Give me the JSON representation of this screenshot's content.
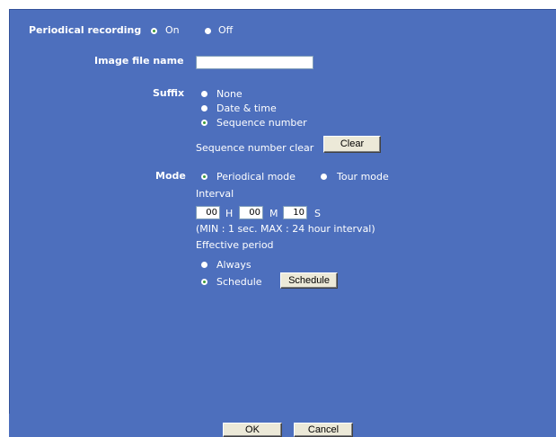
{
  "periodical_recording": {
    "label": "Periodical recording",
    "on_label": "On",
    "off_label": "Off",
    "selected": "On"
  },
  "image_file_name": {
    "label": "Image file name",
    "value": ""
  },
  "suffix": {
    "label": "Suffix",
    "options": [
      "None",
      "Date & time",
      "Sequence number"
    ],
    "selected": "Sequence number",
    "sequence_clear_label": "Sequence number clear",
    "clear_button": "Clear"
  },
  "mode": {
    "label": "Mode",
    "periodical_label": "Periodical mode",
    "tour_label": "Tour mode",
    "selected": "Periodical mode",
    "interval_label": "Interval",
    "hours": "00",
    "hours_unit": "H",
    "minutes": "00",
    "minutes_unit": "M",
    "seconds": "10",
    "seconds_unit": "S",
    "interval_note": "(MIN : 1 sec. MAX : 24 hour interval)",
    "effective_period_label": "Effective period",
    "always_label": "Always",
    "schedule_label": "Schedule",
    "schedule_selected": "Schedule",
    "schedule_button": "Schedule"
  },
  "footer": {
    "ok_button": "OK",
    "cancel_button": "Cancel"
  },
  "colors": {
    "panel_bg": "#4d6fbd",
    "button_face": "#ece9d8",
    "radio_dot": "#3a9a3a"
  }
}
